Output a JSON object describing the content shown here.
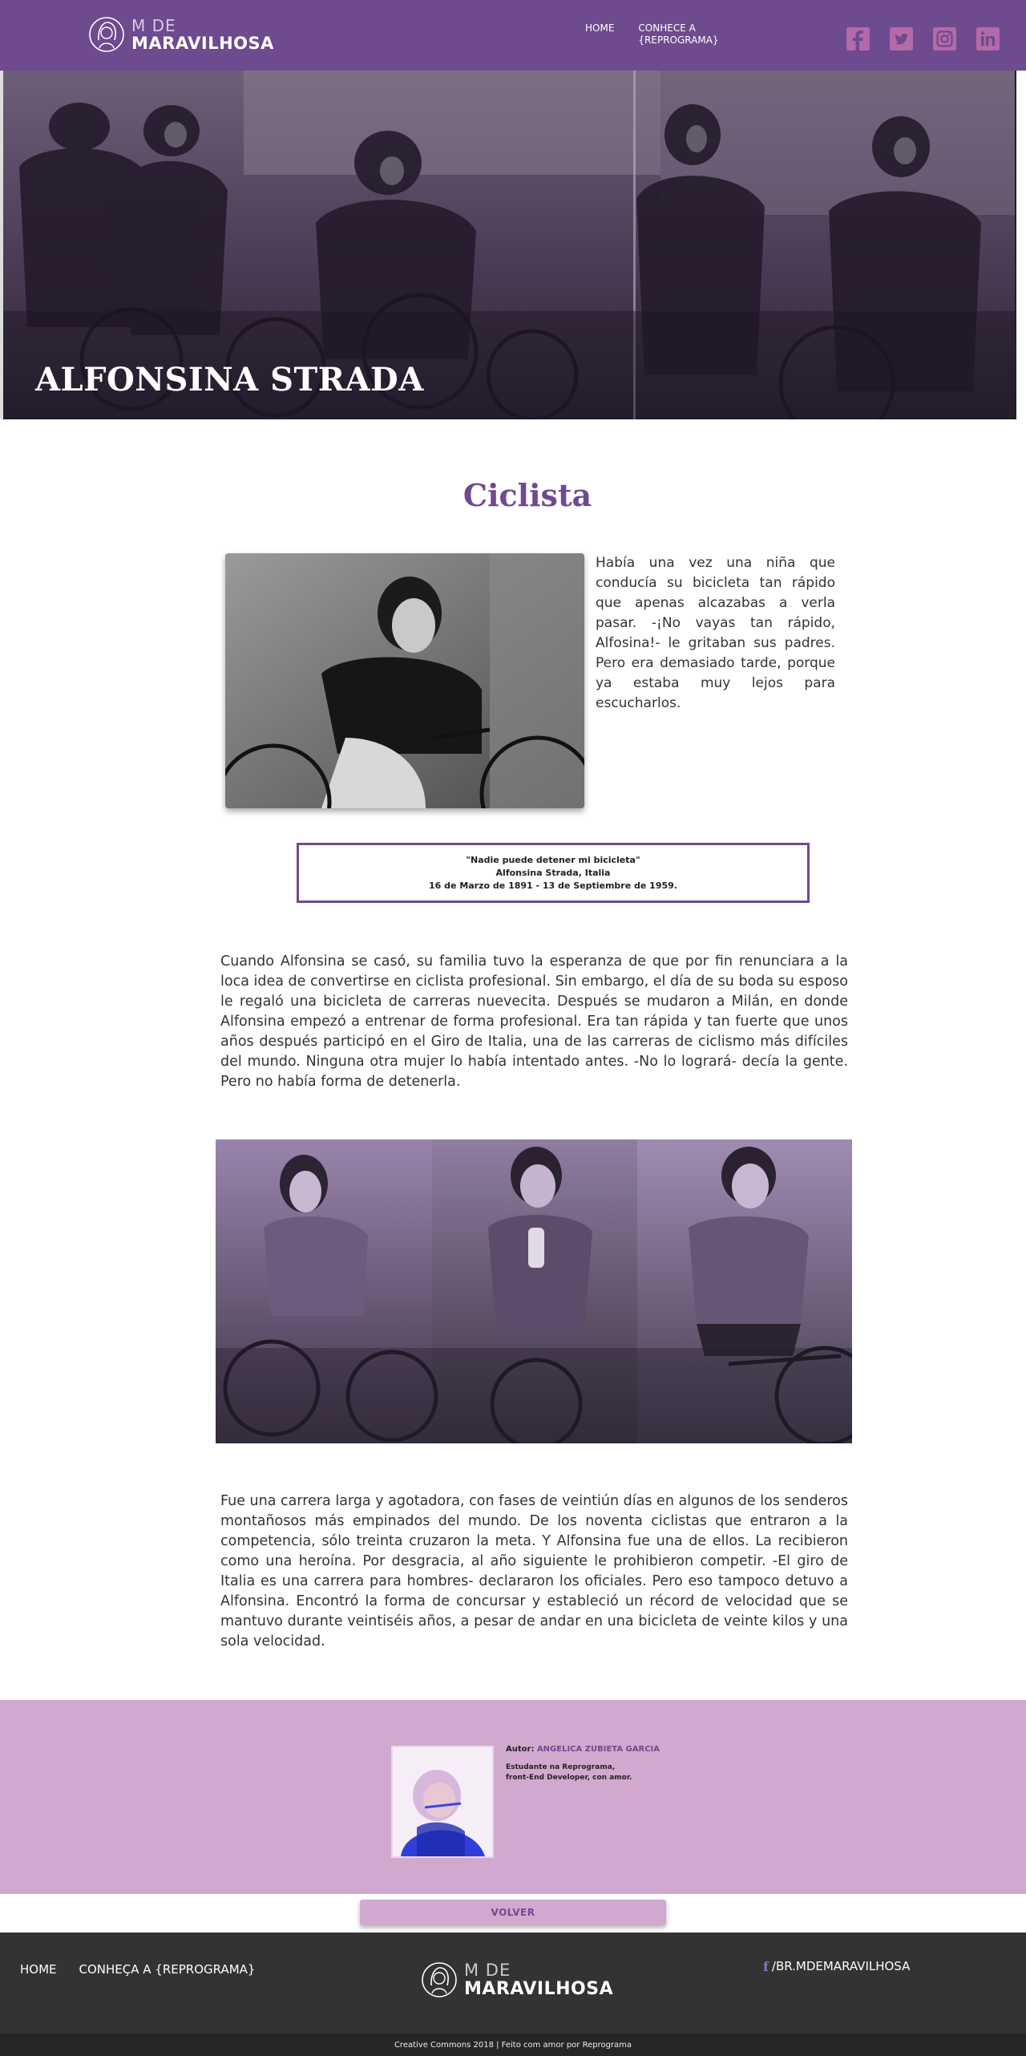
{
  "header": {
    "logo": {
      "line1": "M DE",
      "line2": "MARAVILHOSA"
    },
    "nav": [
      {
        "label": "HOME"
      },
      {
        "label": "CONHECE A {REPROGRAMA}"
      }
    ],
    "social_icons": [
      "facebook-icon",
      "twitter-icon",
      "instagram-icon",
      "linkedin-icon"
    ]
  },
  "hero": {
    "title": "ALFONSINA STRADA"
  },
  "main": {
    "section_title": "Ciclista",
    "intro": "Había una vez una niña que conducía su bicicleta tan rápido que apenas alcazabas a verla pasar. -¡No vayas tan rápido, Alfosina!- le gritaban sus padres. Pero era demasiado tarde, porque ya estaba muy lejos para escucharlos.",
    "quote": {
      "text": "\"Nadie puede detener mi bicicleta\"",
      "author": "Alfonsina Strada, Italia",
      "dates": "16 de Marzo de 1891 - 13 de Septiembre de 1959."
    },
    "paragraph1": "Cuando Alfonsina se casó, su familia tuvo la esperanza de que por fin renunciara a la loca idea de convertirse en ciclista profesional. Sin embargo, el día de su boda su esposo le regaló una bicicleta de carreras nuevecita. Después se mudaron a Milán, en donde Alfonsina empezó a entrenar de forma profesional. Era tan rápida y tan fuerte que unos años después participó en el Giro de Italia, una de las carreras de ciclismo más difíciles del mundo. Ninguna otra mujer lo había intentado antes. -No lo logrará- decía la gente. Pero no había forma de detenerla.",
    "paragraph2": "Fue una carrera larga y agotadora, con fases de veintiún días en algunos de los senderos montañosos más empinados del mundo. De los noventa ciclistas que entraron a la competencia, sólo treinta cruzaron la meta. Y Alfonsina fue una de ellos. La recibieron como una heroína. Por desgracia, al año siguiente le prohibieron competir. -El giro de Italia es una carrera para hombres- declararon los oficiales. Pero eso tampoco detuvo a Alfonsina. Encontró la forma de concursar y estableció un récord de velocidad que se mantuvo durante veintiséis años, a pesar de andar en una bicicleta de veinte kilos y una sola velocidad."
  },
  "author": {
    "label": "Autor:",
    "name": "ANGELICA ZUBIETA GARCIA",
    "bio_line1": "Estudante na Reprograma,",
    "bio_line2": "front-End Developer, con amor."
  },
  "back_button": {
    "label": "VOLVER"
  },
  "footer": {
    "nav": [
      {
        "label": "HOME"
      },
      {
        "label": "CONHEÇA A {REPROGRAMA}"
      }
    ],
    "logo": {
      "line1": "M DE",
      "line2": "MARAVILHOSA"
    },
    "social_glyph": "f",
    "social_handle": "/BR.MDEMARAVILHOSA",
    "copyright": "Creative Commons 2018 | Feito com amor por Reprograma"
  },
  "colors": {
    "brand_purple": "#6e4a8f",
    "light_purple": "#d2a9ce",
    "social_pink": "#b36aa8",
    "footer_dark": "#333333"
  }
}
